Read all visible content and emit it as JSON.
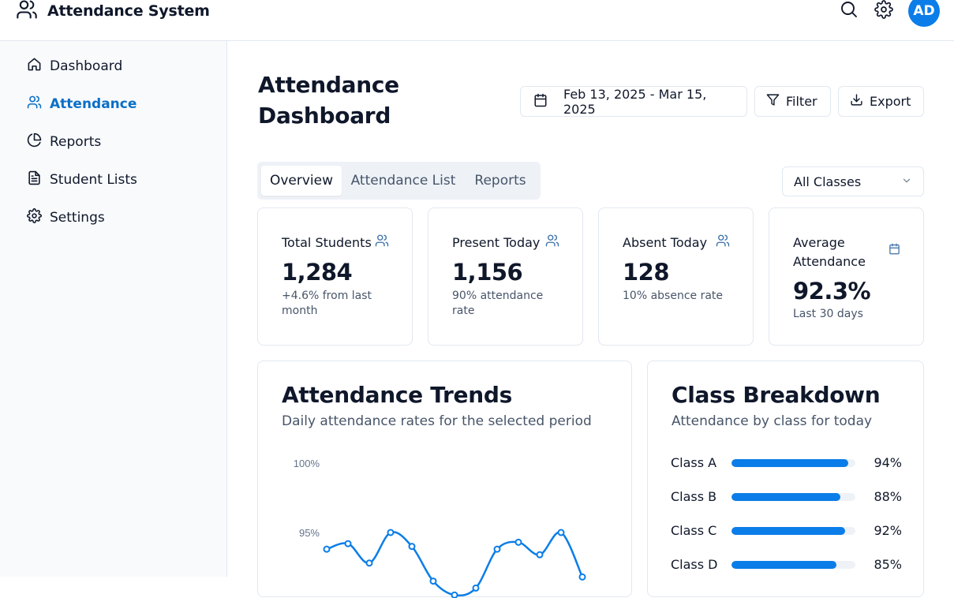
{
  "app": {
    "title": "Attendance System"
  },
  "header": {
    "avatar_initials": "AD",
    "accent": "#0b7de8"
  },
  "sidebar": {
    "items": [
      {
        "label": "Dashboard",
        "icon": "home-icon"
      },
      {
        "label": "Attendance",
        "icon": "users-icon",
        "active": true
      },
      {
        "label": "Reports",
        "icon": "pie-chart-icon"
      },
      {
        "label": "Student Lists",
        "icon": "document-icon"
      },
      {
        "label": "Settings",
        "icon": "gear-icon"
      }
    ]
  },
  "page": {
    "title_line1": "Attendance",
    "title_line2": "Dashboard"
  },
  "toolbar": {
    "date_range": "Feb 13, 2025 - Mar 15, 2025",
    "filter_label": "Filter",
    "export_label": "Export"
  },
  "tabs": [
    {
      "label": "Overview",
      "active": true
    },
    {
      "label": "Attendance List"
    },
    {
      "label": "Reports"
    }
  ],
  "class_select": {
    "value": "All Classes"
  },
  "stats": [
    {
      "label": "Total Students",
      "value": "1,284",
      "sub": "+4.6% from last month",
      "icon": "users-icon"
    },
    {
      "label": "Present Today",
      "value": "1,156",
      "sub": "90% attendance rate",
      "icon": "users-icon"
    },
    {
      "label": "Absent Today",
      "value": "128",
      "sub": "10% absence rate",
      "icon": "users-icon"
    },
    {
      "label": "Average Attendance",
      "value": "92.3%",
      "sub": "Last 30 days",
      "icon": "calendar-icon"
    }
  ],
  "trends": {
    "title": "Attendance Trends",
    "subtitle": "Daily attendance rates for the selected period"
  },
  "breakdown": {
    "title": "Class Breakdown",
    "subtitle": "Attendance by class for today",
    "rows": [
      {
        "label": "Class A",
        "percent": 94,
        "value": "94%"
      },
      {
        "label": "Class B",
        "percent": 88,
        "value": "88%"
      },
      {
        "label": "Class C",
        "percent": 92,
        "value": "92%"
      },
      {
        "label": "Class D",
        "percent": 85,
        "value": "85%"
      }
    ]
  },
  "chart_data": {
    "type": "line",
    "title": "Attendance Trends",
    "subtitle": "Daily attendance rates for the selected period",
    "ytick_labels": [
      "100%",
      "95%"
    ],
    "ylim": [
      90,
      100
    ],
    "x": [
      1,
      2,
      3,
      4,
      5,
      6,
      7,
      8,
      9,
      10,
      11,
      12,
      13
    ],
    "series": [
      {
        "values": [
          93.8,
          94.2,
          92.8,
          95.0,
          94.0,
          91.5,
          90.5,
          91.0,
          93.8,
          94.3,
          93.4,
          95.0,
          91.8
        ]
      }
    ],
    "grid": false
  }
}
